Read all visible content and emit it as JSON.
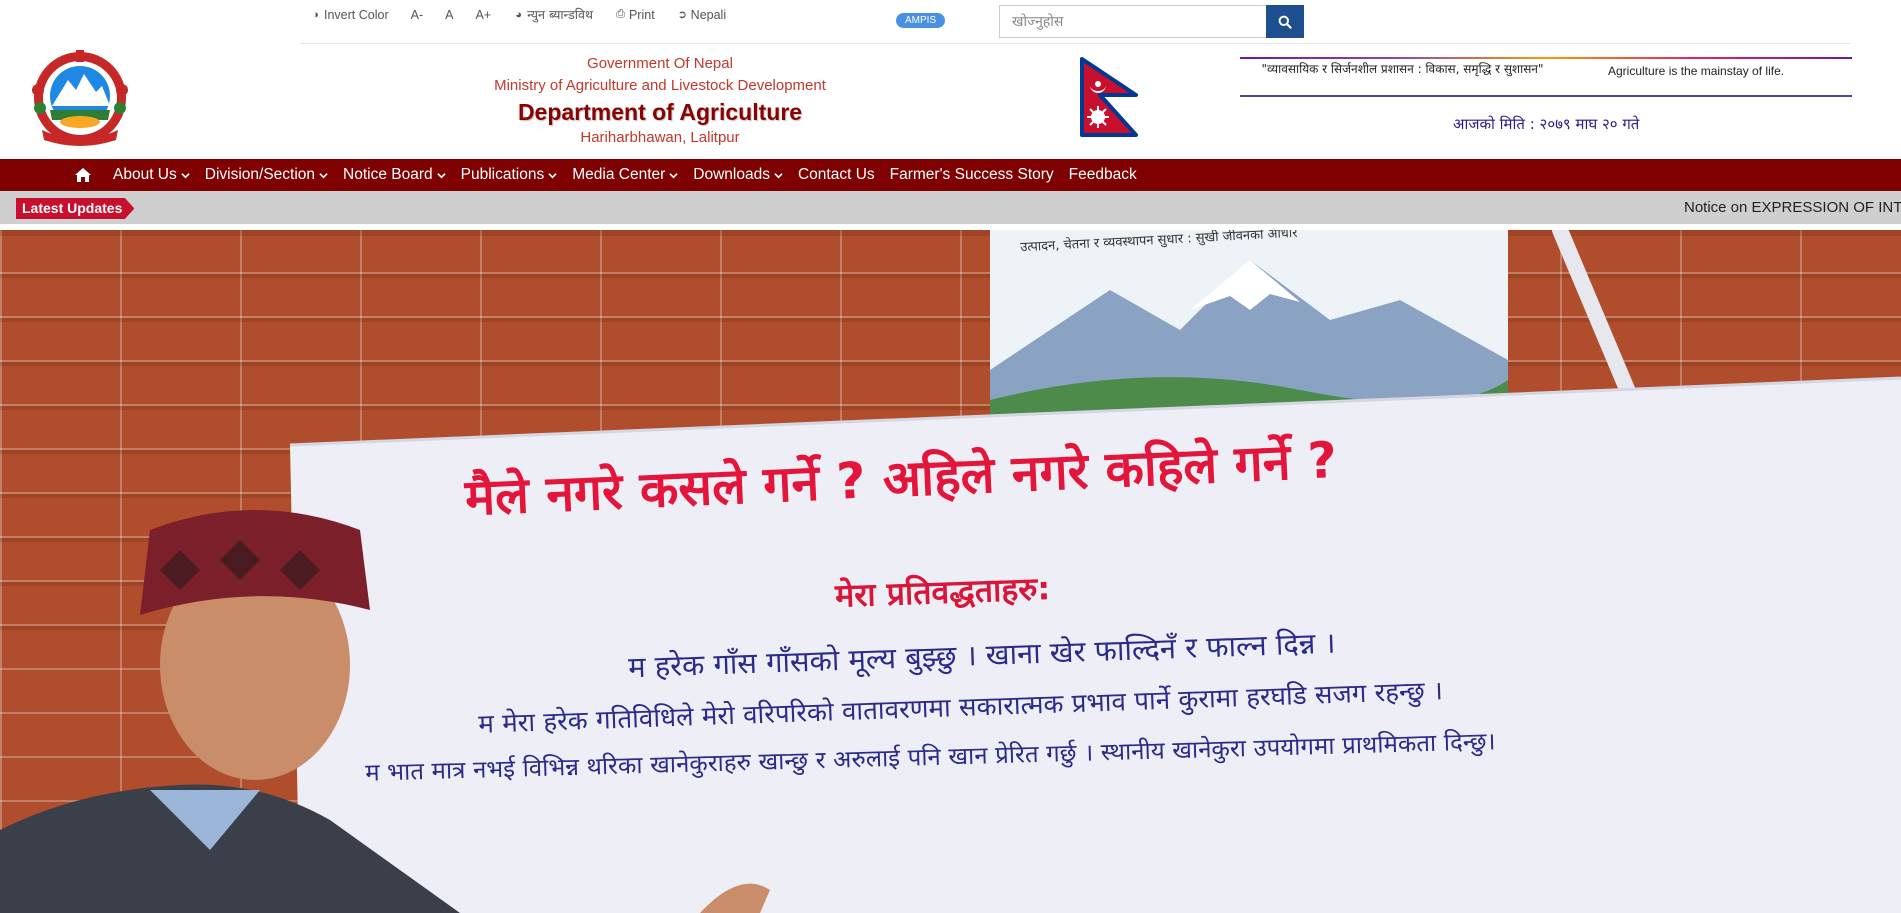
{
  "utility": {
    "invert_color": "Invert Color",
    "font_decrease": "A-",
    "font_normal": "A",
    "font_increase": "A+",
    "low_bandwidth": "न्युन ब्यान्डविथ",
    "print": "Print",
    "language": "Nepali"
  },
  "ampis": "AMPIS",
  "search": {
    "placeholder": "खोज्नुहोस"
  },
  "header": {
    "line1": "Government Of Nepal",
    "line2": "Ministry of Agriculture and Livestock Development",
    "title": "Department of Agriculture",
    "location": "Hariharbhawan, Lalitpur"
  },
  "slogan": {
    "nepali": "\"व्यावसायिक र सिर्जनशील प्रशासन : विकास, समृद्धि र सुशासन\"",
    "english": "Agriculture is the mainstay of life."
  },
  "date": "आजको मिति : २०७९ माघ २० गते",
  "nav": {
    "items": [
      {
        "label": "About Us",
        "dropdown": true
      },
      {
        "label": "Division/Section",
        "dropdown": true
      },
      {
        "label": "Notice Board",
        "dropdown": true
      },
      {
        "label": "Publications",
        "dropdown": true
      },
      {
        "label": "Media Center",
        "dropdown": true
      },
      {
        "label": "Downloads",
        "dropdown": true
      },
      {
        "label": "Contact Us",
        "dropdown": false
      },
      {
        "label": "Farmer's Success Story",
        "dropdown": false
      },
      {
        "label": "Feedback",
        "dropdown": false
      }
    ]
  },
  "ticker": {
    "badge": "Latest Updates",
    "message": "Notice on EXPRESSION OF INT"
  },
  "hero": {
    "headline": "मैले नगरे कसले गर्ने ? अहिले नगरे कहिले गर्ने ?",
    "subheading": "मेरा प्रतिवद्धताहरु:",
    "pledge1": "म हरेक गाँस गाँसको मूल्य बुझ्छु । खाना खेर फाल्दिनँ र फाल्न दिन्न ।",
    "pledge2": "म मेरा हरेक गतिविधिले मेरो वरिपरिको वातावरणमा सकारात्मक प्रभाव पार्ने कुरामा हरघडि सजग रहन्छु ।",
    "pledge3": "म भात मात्र नभई विभिन्न थरिका खानेकुराहरु खान्छु र अरुलाई पनि खान प्रेरित गर्छु । स्थानीय खानेकुरा उपयोगमा प्राथमिकता दिन्छु।",
    "poster_caption": "उत्पादन, चेतना र व्यवस्थापन सुधार : सुखी जीवनको आधार"
  },
  "colors": {
    "nav_bg": "#7f0000",
    "ticker_bg": "#cfcfcf",
    "badge_bg": "#c8102e",
    "title": "#8b0000",
    "subtitle": "#c0392b",
    "search_button": "#1d4f91",
    "ampis_badge": "#4a90e2",
    "date": "#2e1a8a"
  }
}
